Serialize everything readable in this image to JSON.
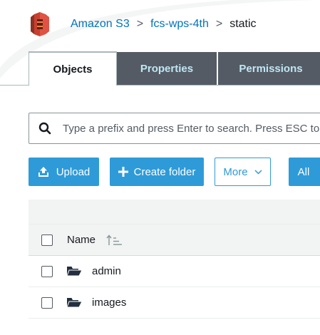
{
  "breadcrumb": {
    "logo_icon": "amazon-s3-logo",
    "items": [
      "Amazon S3",
      "fcs-wps-4th"
    ],
    "separator": ">",
    "current": "static"
  },
  "tabs": [
    {
      "label": "Objects",
      "active": true
    },
    {
      "label": "Properties",
      "active": false
    },
    {
      "label": "Permissions",
      "active": false
    }
  ],
  "search": {
    "icon": "search-icon",
    "placeholder": "Type a prefix and press Enter to search. Press ESC to clear."
  },
  "actions": {
    "upload_label": "Upload",
    "upload_icon": "upload-icon",
    "create_folder_label": "Create folder",
    "create_folder_icon": "plus-icon",
    "more_label": "More",
    "more_icon": "chevron-down-icon",
    "all_label": "All"
  },
  "table": {
    "columns": [
      {
        "label": "Name",
        "sort_icon": "sort-ascending-icon"
      }
    ],
    "rows": [
      {
        "name": "admin",
        "icon": "folder-open-icon"
      },
      {
        "name": "images",
        "icon": "folder-open-icon"
      }
    ]
  },
  "colors": {
    "link": "#0073bb",
    "primary_button": "#2e9bd8",
    "tab_inactive_bg": "#545b64",
    "tab_inactive_text": "#bfe7f4",
    "logo": "#e05243"
  }
}
